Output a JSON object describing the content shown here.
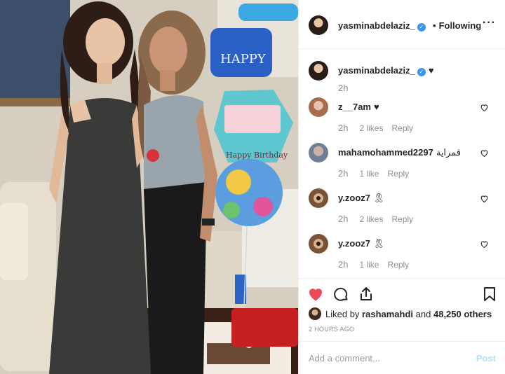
{
  "header": {
    "username": "yasminabdelaziz_",
    "follow_label": "Following",
    "separator": "•",
    "more_label": "···"
  },
  "caption": {
    "username": "yasminabdelaziz_",
    "text": "♥",
    "time": "2h"
  },
  "comments": [
    {
      "username": "z__7am",
      "text": "♥",
      "time": "2h",
      "likes": "2 likes",
      "reply": "Reply"
    },
    {
      "username": "mahamohammed2297",
      "text": "قمراية",
      "time": "2h",
      "likes": "1 like",
      "reply": "Reply"
    },
    {
      "username": "y.zooz7",
      "text": "🎗",
      "time": "2h",
      "likes": "2 likes",
      "reply": "Reply"
    },
    {
      "username": "y.zooz7",
      "text": "🎗",
      "time": "2h",
      "likes": "1 like",
      "reply": "Reply"
    }
  ],
  "likes": {
    "prefix": "Liked by",
    "first_user": "rashamahdi",
    "and": "and",
    "others": "48,250 others"
  },
  "timestamp": "2 HOURS AGO",
  "add_comment": {
    "placeholder": "Add a comment...",
    "post_label": "Post"
  },
  "colors": {
    "heart_red": "#ed4956",
    "verified_blue": "#3897f0",
    "muted": "#8e8e8e",
    "post_disabled": "#b2dffc"
  }
}
